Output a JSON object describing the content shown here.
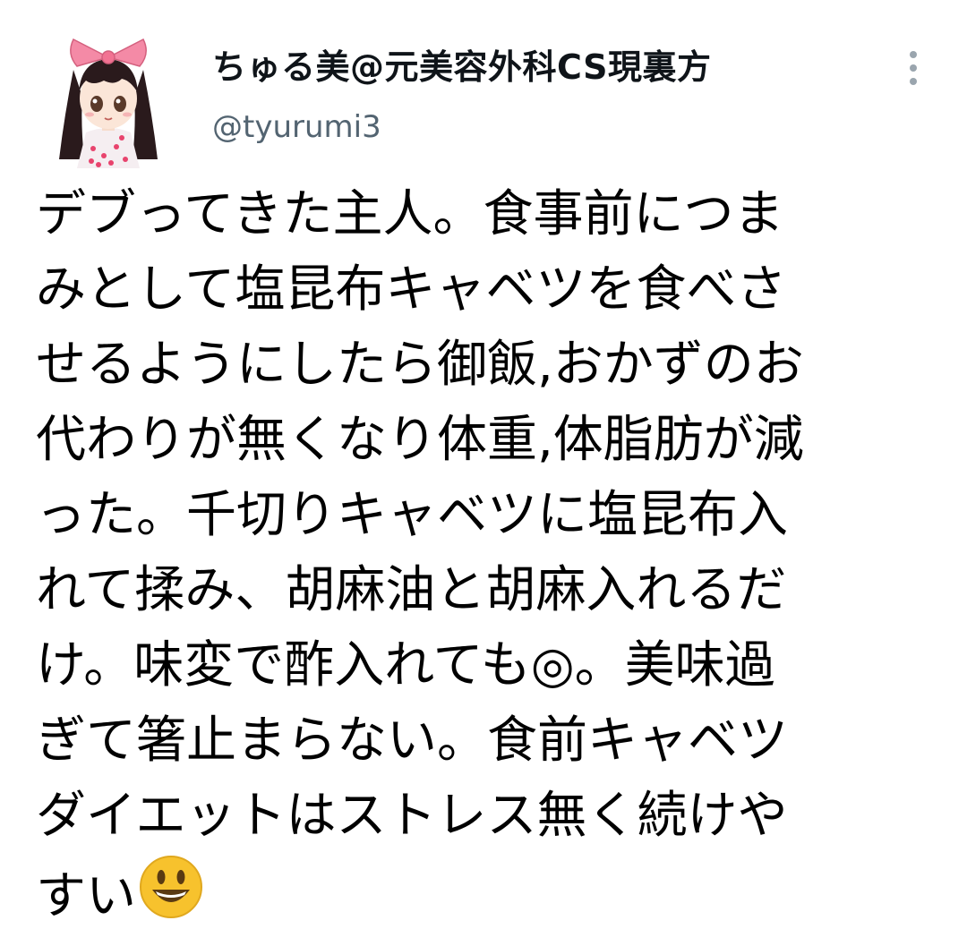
{
  "tweet": {
    "display_name": "ちゅる美@元美容外科CS現裏方",
    "handle": "@tyurumi3",
    "body_lines": [
      "デブってきた主人。食事前につま",
      "みとして塩昆布キャベツを食べさ",
      "せるようにしたら御飯,おかずのお",
      "代わりが無くなり体重,体脂肪が減",
      "った。千切りキャベツに塩昆布入",
      "れて揉み、胡麻油と胡麻入れるだ",
      "け。味変で酢入れても◎。美味過",
      "ぎて箸止まらない。食前キャベツ",
      "ダイエットはストレス無く続けや",
      "すい"
    ],
    "emoji": "smiley-face-emoji"
  },
  "icons": {
    "more": "more-vertical-icon",
    "avatar": "anime-girl-avatar"
  },
  "colors": {
    "name_text": "#0f1419",
    "handle_text": "#536471",
    "body_text": "#000000",
    "more_dots": "#9aa5ae",
    "emoji_face": "#f7c22d",
    "avatar_bow": "#f48aa6"
  }
}
